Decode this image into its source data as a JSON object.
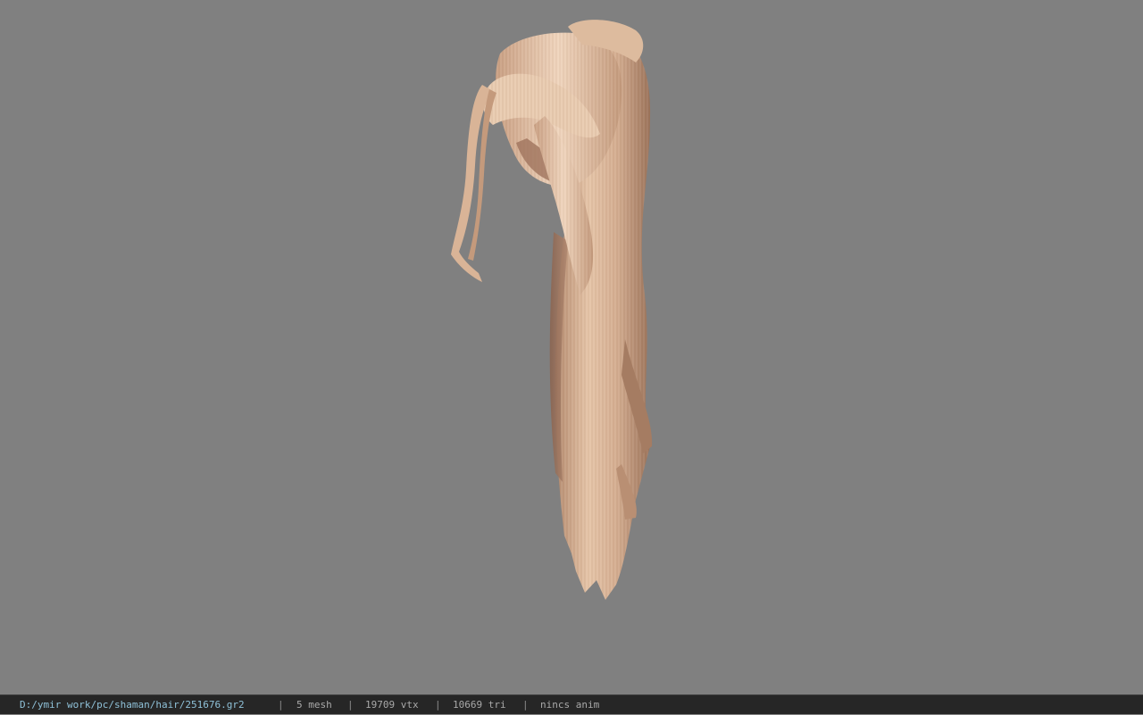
{
  "status_bar": {
    "file_path": "D:/ymir work/pc/shaman/hair/251676.gr2",
    "separator": "|",
    "mesh_count": "5 mesh",
    "vertex_count": "19709 vtx",
    "triangle_count": "10669 tri",
    "animation": "nincs anim"
  },
  "viewport": {
    "background_color": "#808080",
    "model": "hair-model"
  }
}
